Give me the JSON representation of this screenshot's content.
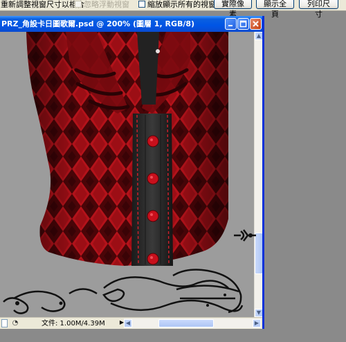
{
  "options_bar": {
    "resize_windows_label": "重新調整視窗尺寸以相合",
    "ignore_palettes_label": "忽略浮動視窗",
    "zoom_all_windows_label": "縮放顯示所有的視窗",
    "actual_pixels_label": "實際像素",
    "fit_screen_label": "顯示全頁",
    "print_size_label": "列印尺寸"
  },
  "document": {
    "title": "PRZ_角設卡日圖歌爾.psd @ 200% (圖層 1, RGB/8)",
    "status_text": "文件: 1.00M/4.39M"
  },
  "icons": {
    "minimize": "minimize-icon",
    "maximize": "maximize-icon",
    "close": "close-icon"
  },
  "colors": {
    "titlebar": "#0055e5",
    "vest_red": "#b01018",
    "vest_dark": "#2a0a0c"
  }
}
